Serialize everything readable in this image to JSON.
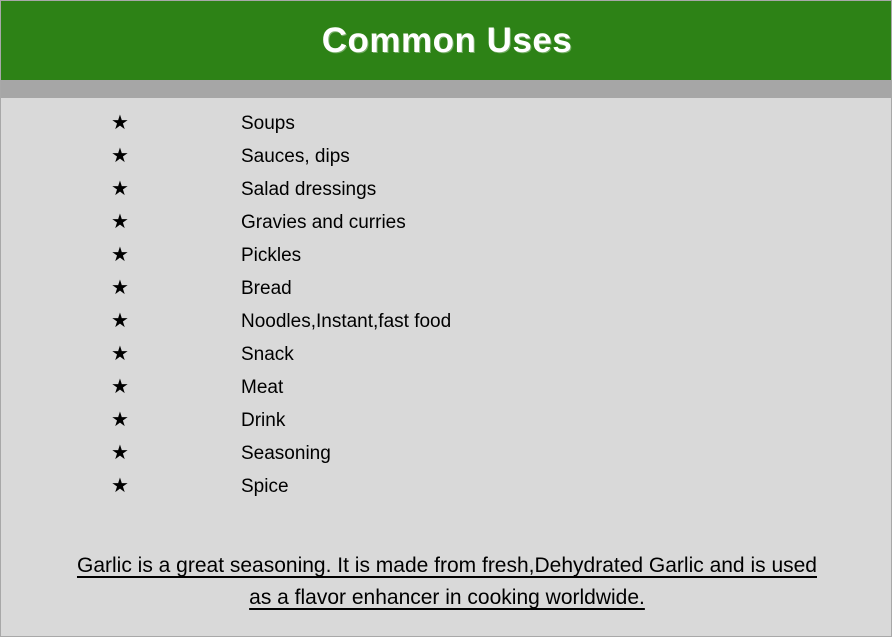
{
  "header": {
    "title": "Common Uses",
    "background_color": "#2d8216",
    "title_color": "#ffffff"
  },
  "separator": {
    "color": "#a6a6a6"
  },
  "body": {
    "background_color": "#d9d9d9",
    "bullet_glyph": "★",
    "items": [
      {
        "label": "Soups"
      },
      {
        "label": "Sauces, dips"
      },
      {
        "label": "Salad dressings"
      },
      {
        "label": "Gravies and curries"
      },
      {
        "label": "Pickles"
      },
      {
        "label": "Bread"
      },
      {
        "label": "Noodles,Instant,fast food"
      },
      {
        "label": "Snack"
      },
      {
        "label": "Meat"
      },
      {
        "label": "Drink"
      },
      {
        "label": "Seasoning"
      },
      {
        "label": "Spice"
      }
    ]
  },
  "footer": {
    "line1": "Garlic is a great seasoning. It is made from fresh,Dehydrated Garlic and is used",
    "line2": "as a flavor enhancer in cooking worldwide."
  }
}
